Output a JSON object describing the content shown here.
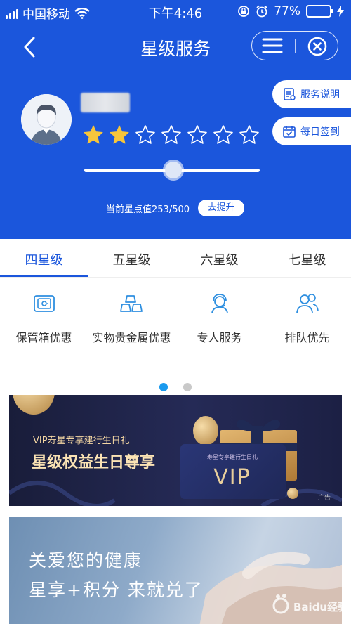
{
  "status_bar": {
    "carrier": "中国移动",
    "time": "下午4:46",
    "battery": "77%",
    "battery_level": 0.77
  },
  "navbar": {
    "title": "星级服务",
    "back_icon": "chevron-left-icon",
    "menu_icon": "menu-icon",
    "close_icon": "circle-close-icon"
  },
  "side_buttons": {
    "service_info": "服务说明",
    "daily_checkin": "每日签到"
  },
  "profile": {
    "stars_filled": 2,
    "stars_total": 7,
    "progress_fraction": 0.506,
    "star_value_text": "当前星点值253/500",
    "improve_label": "去提升"
  },
  "tabs": [
    {
      "label": "四星级",
      "active": true
    },
    {
      "label": "五星级",
      "active": false
    },
    {
      "label": "六星级",
      "active": false
    },
    {
      "label": "七星级",
      "active": false
    }
  ],
  "benefits": [
    {
      "label": "保管箱优惠",
      "icon": "safe-box-icon"
    },
    {
      "label": "实物贵金属优惠",
      "icon": "gold-bars-icon"
    },
    {
      "label": "专人服务",
      "icon": "headset-person-icon"
    },
    {
      "label": "排队优先",
      "icon": "people-queue-icon"
    }
  ],
  "pager": {
    "active_index": 0,
    "count": 2
  },
  "banner1": {
    "subtitle": "VIP寿星专享建行生日礼",
    "title": "星级权益生日尊享",
    "ticket_subtitle": "寿星专享建行生日礼",
    "ticket_text": "VIP",
    "ad_label": "广告"
  },
  "banner2": {
    "line1": "关爱您的健康",
    "line2": "星享+积分 来就兑了"
  },
  "watermark": {
    "text": "Baidu经验"
  },
  "colors": {
    "brand_blue": "#1b56dc",
    "star_gold": "#f6c53b",
    "pager_active": "#1a9aee"
  }
}
